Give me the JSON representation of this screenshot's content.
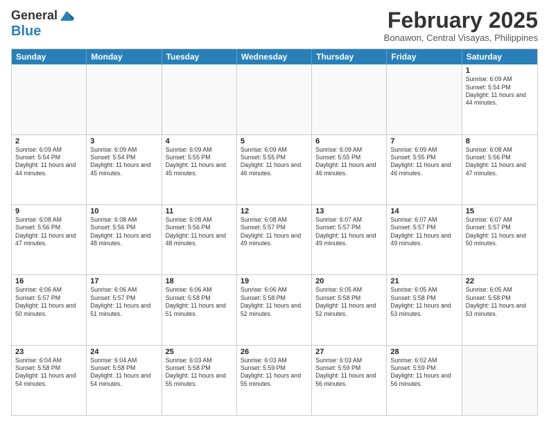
{
  "header": {
    "logo_line1": "General",
    "logo_line2": "Blue",
    "month_title": "February 2025",
    "location": "Bonawon, Central Visayas, Philippines"
  },
  "weekdays": [
    "Sunday",
    "Monday",
    "Tuesday",
    "Wednesday",
    "Thursday",
    "Friday",
    "Saturday"
  ],
  "rows": [
    [
      {
        "day": "",
        "empty": true
      },
      {
        "day": "",
        "empty": true
      },
      {
        "day": "",
        "empty": true
      },
      {
        "day": "",
        "empty": true
      },
      {
        "day": "",
        "empty": true
      },
      {
        "day": "",
        "empty": true
      },
      {
        "day": "1",
        "sunrise": "6:09 AM",
        "sunset": "5:54 PM",
        "daylight": "11 hours and 44 minutes."
      }
    ],
    [
      {
        "day": "2",
        "sunrise": "6:09 AM",
        "sunset": "5:54 PM",
        "daylight": "11 hours and 44 minutes."
      },
      {
        "day": "3",
        "sunrise": "6:09 AM",
        "sunset": "5:54 PM",
        "daylight": "11 hours and 45 minutes."
      },
      {
        "day": "4",
        "sunrise": "6:09 AM",
        "sunset": "5:55 PM",
        "daylight": "11 hours and 45 minutes."
      },
      {
        "day": "5",
        "sunrise": "6:09 AM",
        "sunset": "5:55 PM",
        "daylight": "11 hours and 46 minutes."
      },
      {
        "day": "6",
        "sunrise": "6:09 AM",
        "sunset": "5:55 PM",
        "daylight": "11 hours and 46 minutes."
      },
      {
        "day": "7",
        "sunrise": "6:09 AM",
        "sunset": "5:55 PM",
        "daylight": "11 hours and 46 minutes."
      },
      {
        "day": "8",
        "sunrise": "6:08 AM",
        "sunset": "5:56 PM",
        "daylight": "11 hours and 47 minutes."
      }
    ],
    [
      {
        "day": "9",
        "sunrise": "6:08 AM",
        "sunset": "5:56 PM",
        "daylight": "11 hours and 47 minutes."
      },
      {
        "day": "10",
        "sunrise": "6:08 AM",
        "sunset": "5:56 PM",
        "daylight": "11 hours and 48 minutes."
      },
      {
        "day": "11",
        "sunrise": "6:08 AM",
        "sunset": "5:56 PM",
        "daylight": "11 hours and 48 minutes."
      },
      {
        "day": "12",
        "sunrise": "6:08 AM",
        "sunset": "5:57 PM",
        "daylight": "11 hours and 49 minutes."
      },
      {
        "day": "13",
        "sunrise": "6:07 AM",
        "sunset": "5:57 PM",
        "daylight": "11 hours and 49 minutes."
      },
      {
        "day": "14",
        "sunrise": "6:07 AM",
        "sunset": "5:57 PM",
        "daylight": "11 hours and 49 minutes."
      },
      {
        "day": "15",
        "sunrise": "6:07 AM",
        "sunset": "5:57 PM",
        "daylight": "11 hours and 50 minutes."
      }
    ],
    [
      {
        "day": "16",
        "sunrise": "6:06 AM",
        "sunset": "5:57 PM",
        "daylight": "11 hours and 50 minutes."
      },
      {
        "day": "17",
        "sunrise": "6:06 AM",
        "sunset": "5:57 PM",
        "daylight": "11 hours and 51 minutes."
      },
      {
        "day": "18",
        "sunrise": "6:06 AM",
        "sunset": "5:58 PM",
        "daylight": "11 hours and 51 minutes."
      },
      {
        "day": "19",
        "sunrise": "6:06 AM",
        "sunset": "5:58 PM",
        "daylight": "11 hours and 52 minutes."
      },
      {
        "day": "20",
        "sunrise": "6:05 AM",
        "sunset": "5:58 PM",
        "daylight": "11 hours and 52 minutes."
      },
      {
        "day": "21",
        "sunrise": "6:05 AM",
        "sunset": "5:58 PM",
        "daylight": "11 hours and 53 minutes."
      },
      {
        "day": "22",
        "sunrise": "6:05 AM",
        "sunset": "5:58 PM",
        "daylight": "11 hours and 53 minutes."
      }
    ],
    [
      {
        "day": "23",
        "sunrise": "6:04 AM",
        "sunset": "5:58 PM",
        "daylight": "11 hours and 54 minutes."
      },
      {
        "day": "24",
        "sunrise": "6:04 AM",
        "sunset": "5:58 PM",
        "daylight": "11 hours and 54 minutes."
      },
      {
        "day": "25",
        "sunrise": "6:03 AM",
        "sunset": "5:58 PM",
        "daylight": "11 hours and 55 minutes."
      },
      {
        "day": "26",
        "sunrise": "6:03 AM",
        "sunset": "5:59 PM",
        "daylight": "11 hours and 55 minutes."
      },
      {
        "day": "27",
        "sunrise": "6:03 AM",
        "sunset": "5:59 PM",
        "daylight": "11 hours and 56 minutes."
      },
      {
        "day": "28",
        "sunrise": "6:02 AM",
        "sunset": "5:59 PM",
        "daylight": "11 hours and 56 minutes."
      },
      {
        "day": "",
        "empty": true
      }
    ]
  ]
}
